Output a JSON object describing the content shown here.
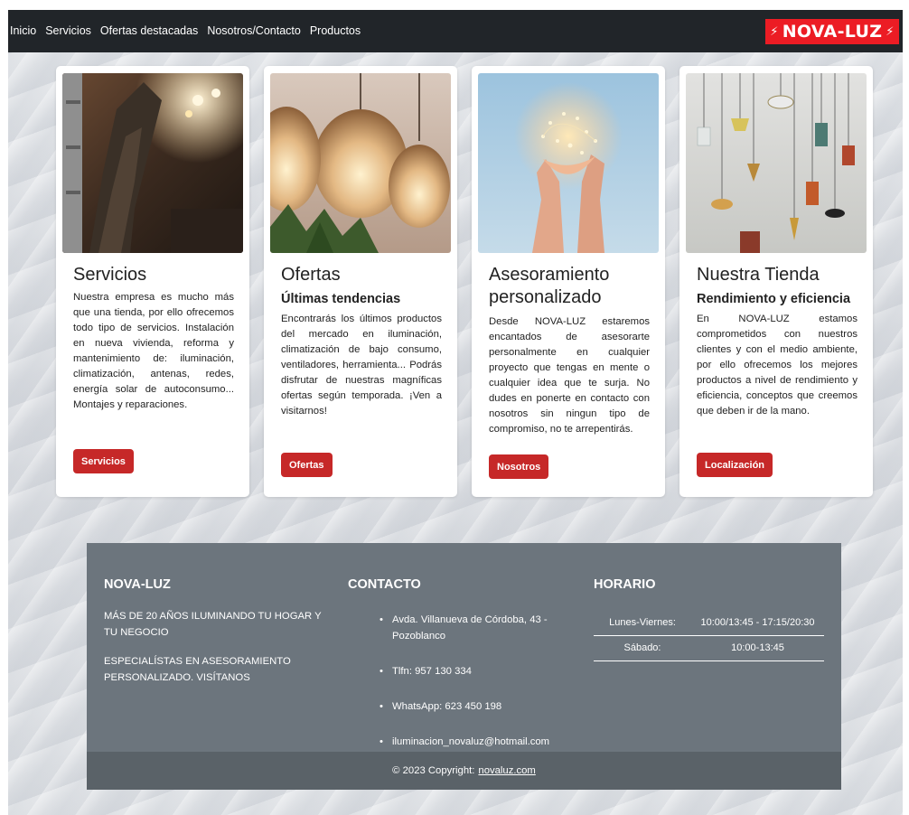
{
  "nav": {
    "links": [
      "Inicio",
      "Servicios",
      "Ofertas destacadas",
      "Nosotros/Contacto",
      "Productos"
    ],
    "brand": "NOVA-LUZ",
    "brand_color": "#ec1c24"
  },
  "cards": [
    {
      "title": "Servicios",
      "subtitle": "",
      "text": "Nuestra empresa es mucho más que una tienda, por ello ofrecemos todo tipo de servicios. Instalación en nueva vivienda, reforma y mantenimiento de: iluminación, climatización, antenas, redes, energía solar de autoconsumo... Montajes y reparaciones.",
      "button": "Servicios"
    },
    {
      "title": "Ofertas",
      "subtitle": "Últimas tendencias",
      "text": "Encontrarás los últimos productos del mercado en iluminación, climatización de bajo consumo, ventiladores, herramienta... Podrás disfrutar de nuestras magníficas ofertas según temporada. ¡Ven a visitarnos!",
      "button": "Ofertas"
    },
    {
      "title": "Asesoramiento personalizado",
      "subtitle": "",
      "text": "Desde NOVA-LUZ estaremos encantados de asesorarte personalmente en cualquier proyecto que tengas en mente o cualquier idea que te surja. No dudes en ponerte en contacto con nosotros sin ningun tipo de compromiso, no te arrepentirás.",
      "button": "Nosotros"
    },
    {
      "title": "Nuestra Tienda",
      "subtitle": "Rendimiento y eficiencia",
      "text": "En NOVA-LUZ estamos comprometidos con nuestros clientes y con el medio ambiente, por ello ofrecemos los mejores productos a nivel de rendimiento y eficiencia, conceptos que creemos que deben ir de la mano.",
      "button": "Localización"
    }
  ],
  "footer": {
    "about": {
      "title": "NOVA-LUZ",
      "line1": "MÁS DE 20 AÑOS ILUMINANDO TU HOGAR Y TU NEGOCIO",
      "line2": "ESPECIALÍSTAS EN ASESORAMIENTO PERSONALIZADO. VISÍTANOS"
    },
    "contact": {
      "title": "CONTACTO",
      "items": [
        "Avda. Villanueva de Córdoba, 43 - Pozoblanco",
        "Tlfn: 957 130 334",
        "WhatsApp: 623 450 198",
        "iluminacion_novaluz@hotmail.com"
      ]
    },
    "hours": {
      "title": "HORARIO",
      "rows": [
        {
          "day": "Lunes-Viernes:",
          "time": "10:00/13:45 - 17:15/20:30"
        },
        {
          "day": "Sábado:",
          "time": "10:00-13:45"
        }
      ]
    },
    "copyright": "© 2023 Copyright:",
    "copyright_link": "novaluz.com"
  },
  "colors": {
    "navbar_bg": "#212529",
    "button_red": "#c62828",
    "footer_bg": "#6c757d",
    "footer_bottom": "#5a6268"
  }
}
